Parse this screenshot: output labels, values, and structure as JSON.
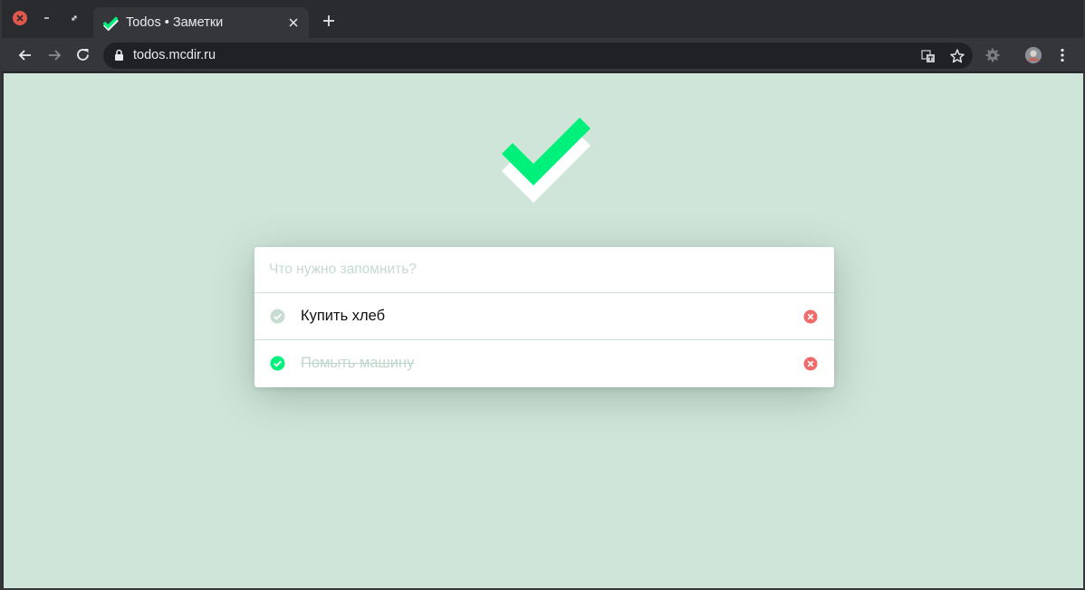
{
  "browser": {
    "tab": {
      "title": "Todos • Заметки",
      "favicon": "check-favicon-icon"
    },
    "url": "todos.mcdir.ru",
    "colors": {
      "tabstrip": "#2a2b2e",
      "toolbar": "#35363a",
      "omnibox": "#202124"
    }
  },
  "page": {
    "logo": "check-logo-icon",
    "background": "#d0e5da",
    "input": {
      "placeholder": "Что нужно запомнить?",
      "value": ""
    },
    "todos": [
      {
        "text": "Купить хлеб",
        "completed": false
      },
      {
        "text": "Помыть машину",
        "completed": true
      }
    ],
    "colors": {
      "accent": "#00f07c",
      "delete": "#f06b6b",
      "inactive_check": "#c8ddd2"
    }
  }
}
